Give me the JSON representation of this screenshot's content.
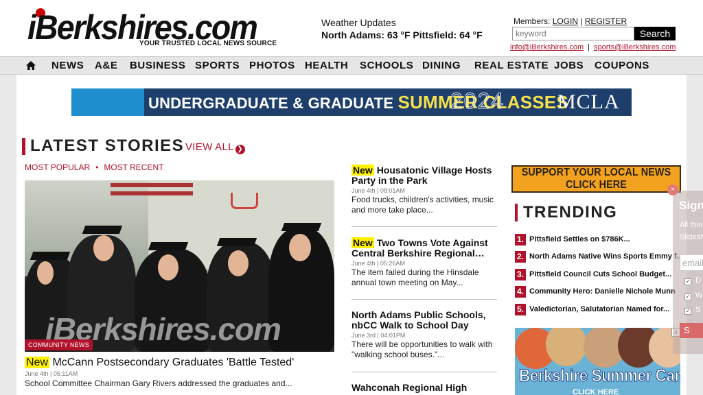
{
  "header": {
    "logo_text": "iBerkshires.com",
    "tagline": "YOUR TRUSTED LOCAL NEWS SOURCE",
    "weather_title": "Weather Updates",
    "weather_temps": "North Adams: 63 °F Pittsfield: 64 °F",
    "members_label": "Members:",
    "login": "LOGIN",
    "register": "REGISTER",
    "search_placeholder": "keyword",
    "search_button": "Search",
    "email_info": "info@iBerkshires.com",
    "email_sports": "sports@iBerkshires.com",
    "email_sep": "|"
  },
  "nav": {
    "home_icon": "home-icon",
    "items": [
      "NEWS",
      "A&E",
      "BUSINESS",
      "SPORTS",
      "PHOTOS",
      "HEALTH",
      "SCHOOLS",
      "DINING",
      "REAL ESTATE",
      "JOBS",
      "COUPONS"
    ]
  },
  "banner": {
    "text_a": "UNDERGRADUATE & GRADUATE ",
    "text_b": "SUMMER CLASSES",
    "year": "2024",
    "brand": "MCLA"
  },
  "latest": {
    "title": "LATEST STORIES",
    "view_all": "VIEW ALL",
    "tab_popular": "MOST POPULAR",
    "tab_sep": "•",
    "tab_recent": "MOST RECENT",
    "photo_watermark": "iBerkshires.com",
    "photo_tag": "COMMUNITY NEWS",
    "new_label": "New",
    "main_story": {
      "headline": "McCann Postsecondary Graduates 'Battle Tested'",
      "date": "June 4th | 05:11AM",
      "summary": "School Committee Chairman Gary Rivers addressed the graduates and..."
    },
    "stories": [
      {
        "is_new": "New",
        "headline": "Housatonic Village Hosts Party in the Park",
        "date": "June 4th | 08:01AM",
        "summary": "Food trucks, children's activities, music and more take place..."
      },
      {
        "is_new": "New",
        "headline": "Two Towns Vote Against Central Berkshire Regional…",
        "date": "June 4th | 05:26AM",
        "summary": "The item failed during the Hinsdale annual town meeting on May..."
      },
      {
        "is_new": "",
        "headline": "North Adams Public Schools, nbCC Walk to School Day",
        "date": "June 3rd | 04:01PM",
        "summary": "There will be opportunities to walk with \"walking school buses.\"..."
      },
      {
        "is_new": "",
        "headline": "Wahconah Regional High",
        "date": "",
        "summary": ""
      }
    ]
  },
  "sidebar": {
    "support_line1": "SUPPORT YOUR LOCAL NEWS",
    "support_line2": "CLICK HERE",
    "trending_title": "TRENDING",
    "trending": [
      {
        "num": "1.",
        "text": "Pittsfield Settles on $786K..."
      },
      {
        "num": "2.",
        "text": "North Adams Native Wins Sports Emmy f..."
      },
      {
        "num": "3.",
        "text": "Pittsfield Council Cuts School Budget..."
      },
      {
        "num": "4.",
        "text": "Community Hero: Danielle Nichole Munn"
      },
      {
        "num": "5.",
        "text": "Valedictorian, Salutatorian Named for..."
      }
    ],
    "ad_title": "Berkshire Summer Camps",
    "ad_cta": "CLICK HERE",
    "ad_close": "x"
  },
  "signup": {
    "close": "×",
    "title": "Sign",
    "desc_1": "All thin",
    "desc_2": "Slidesh",
    "email_placeholder": "email",
    "opt_1": "D",
    "opt_2": "W",
    "opt_3": "S",
    "button": "S"
  },
  "colors": {
    "accent": "#b0122b",
    "nav_bg": "#e6e6e6",
    "new_highlight": "#fff200",
    "support_bg": "#f2a21e"
  }
}
